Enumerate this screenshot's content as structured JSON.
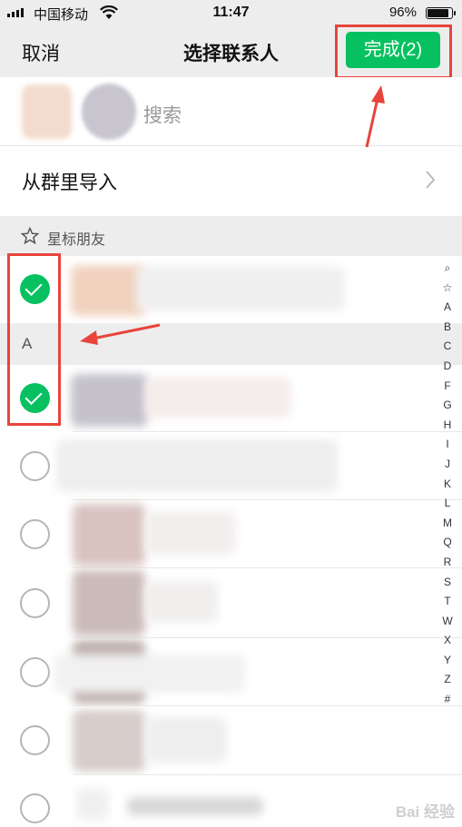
{
  "status_bar": {
    "carrier": "中国移动",
    "time": "11:47",
    "battery_percent": "96%",
    "battery_level": 0.96
  },
  "nav": {
    "cancel_label": "取消",
    "title": "选择联系人",
    "done_label": "完成(2)"
  },
  "search": {
    "placeholder": "搜索"
  },
  "import_group": {
    "label": "从群里导入"
  },
  "sections": {
    "starred": "星标朋友",
    "a": "A"
  },
  "index_letters": [
    "⌕",
    "☆",
    "A",
    "B",
    "C",
    "D",
    "F",
    "G",
    "H",
    "I",
    "J",
    "K",
    "L",
    "M",
    "Q",
    "R",
    "S",
    "T",
    "W",
    "X",
    "Y",
    "Z",
    "#"
  ],
  "contacts": [
    {
      "checked": true
    },
    {
      "checked": true
    },
    {
      "checked": false
    },
    {
      "checked": false
    },
    {
      "checked": false
    },
    {
      "checked": false
    },
    {
      "checked": false
    },
    {
      "checked": false
    }
  ],
  "colors": {
    "accent": "#07c160",
    "highlight": "#e8443b",
    "nav_bg": "#ededed"
  },
  "watermark": "Bai 经验"
}
